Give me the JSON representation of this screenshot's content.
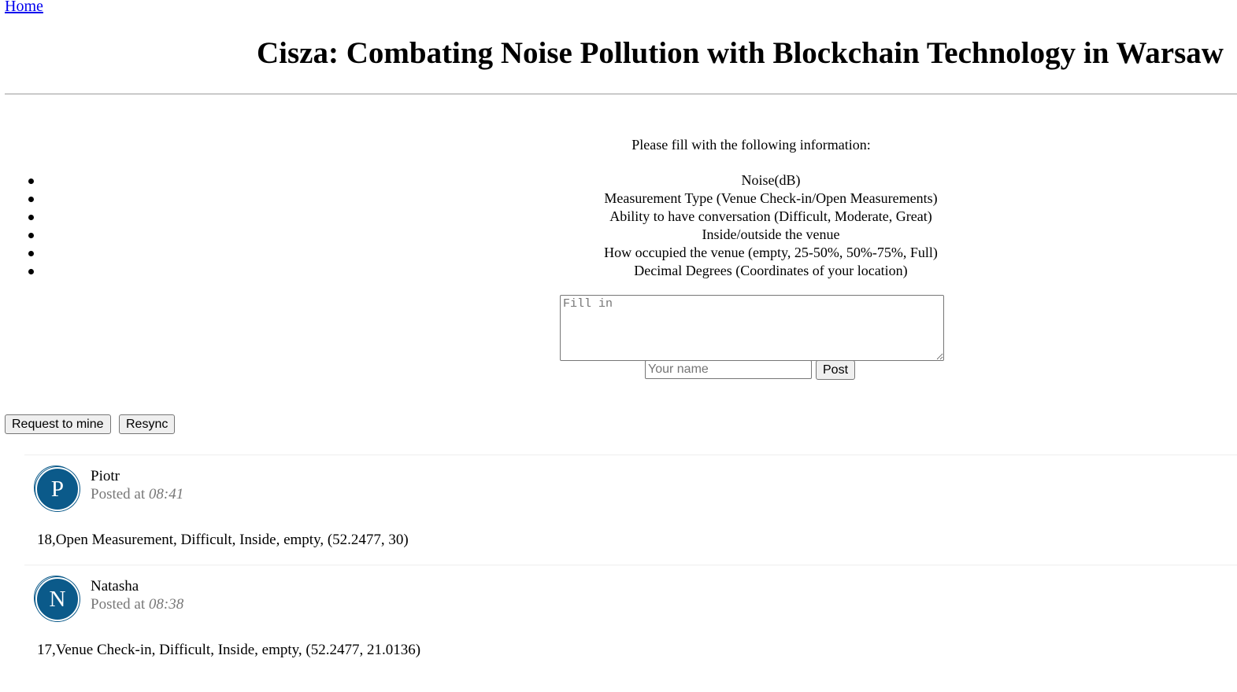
{
  "nav": {
    "home_label": "Home"
  },
  "header": {
    "title": "Cisza: Combating Noise Pollution with Blockchain Technology in Warsaw"
  },
  "form": {
    "intro": "Please fill with the following information:",
    "requirements": [
      "Noise(dB)",
      "Measurement Type (Venue Check-in/Open Measurements)",
      "Ability to have conversation (Difficult, Moderate, Great)",
      "Inside/outside the venue",
      "How occupied the venue (empty, 25-50%, 50%-75%, Full)",
      "Decimal Degrees (Coordinates of your location)"
    ],
    "textarea_placeholder": "Fill in",
    "name_placeholder": "Your name",
    "post_label": "Post"
  },
  "actions": {
    "mine_label": "Request to mine",
    "resync_label": "Resync"
  },
  "posts": [
    {
      "initial": "P",
      "author": "Piotr",
      "posted_prefix": "Posted at",
      "time": "08:41",
      "content": "18,Open Measurement, Difficult, Inside, empty, (52.2477, 30)"
    },
    {
      "initial": "N",
      "author": "Natasha",
      "posted_prefix": "Posted at",
      "time": "08:38",
      "content": "17,Venue Check-in, Difficult, Inside, empty, (52.2477, 21.0136)"
    }
  ],
  "colors": {
    "avatar_bg": "#0b5a8a",
    "link": "#0000ee",
    "muted": "#777777"
  }
}
